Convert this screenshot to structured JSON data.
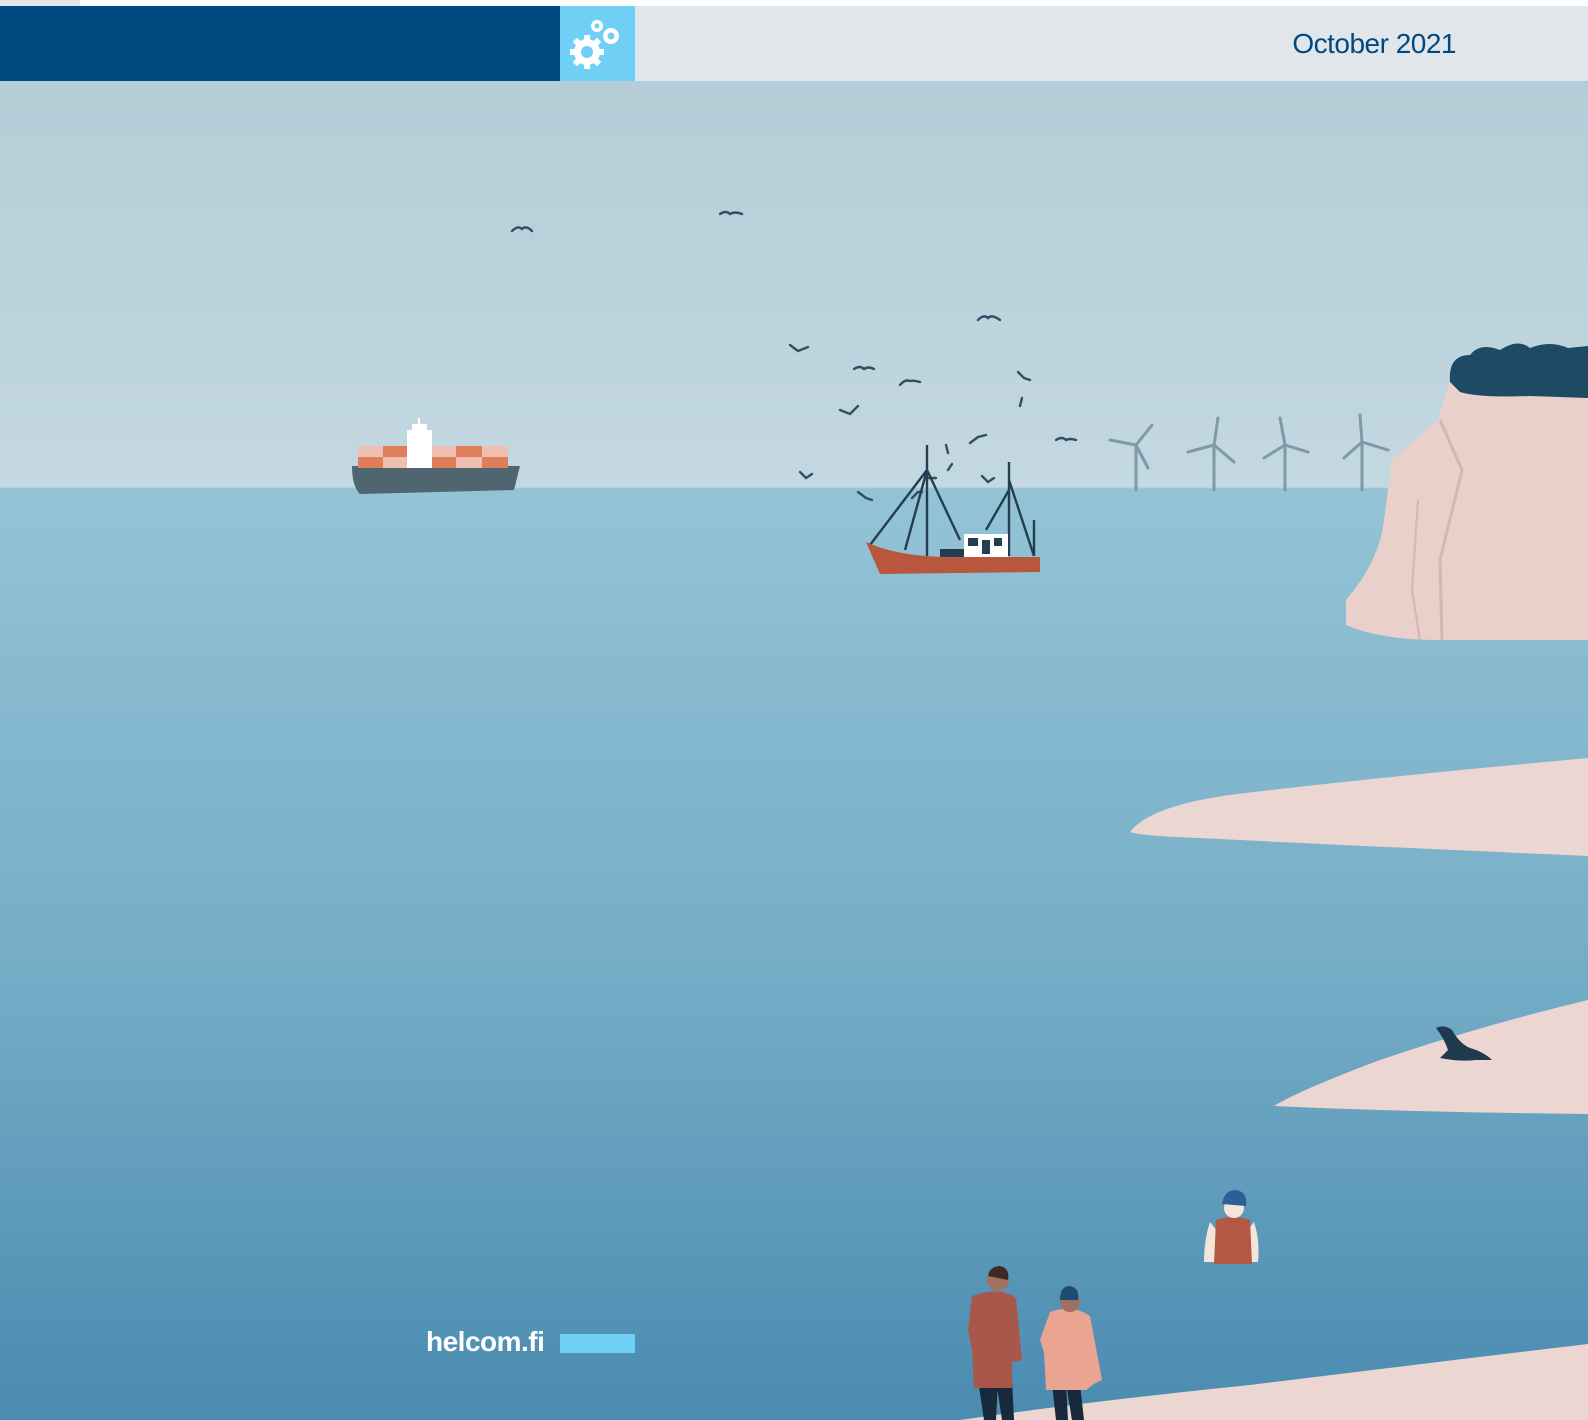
{
  "header": {
    "date": "October 2021",
    "icon": "gears-icon"
  },
  "footer": {
    "url": "helcom.fi"
  },
  "colors": {
    "navy": "#004a82",
    "light_blue": "#6fcff5",
    "header_grey": "#e1e6ea",
    "sky": "#bcd3de",
    "sea_top": "#8fc1d6",
    "sea_bottom": "#4e8fb3",
    "sand": "#ecd6d1",
    "date_text": "#004a82"
  }
}
